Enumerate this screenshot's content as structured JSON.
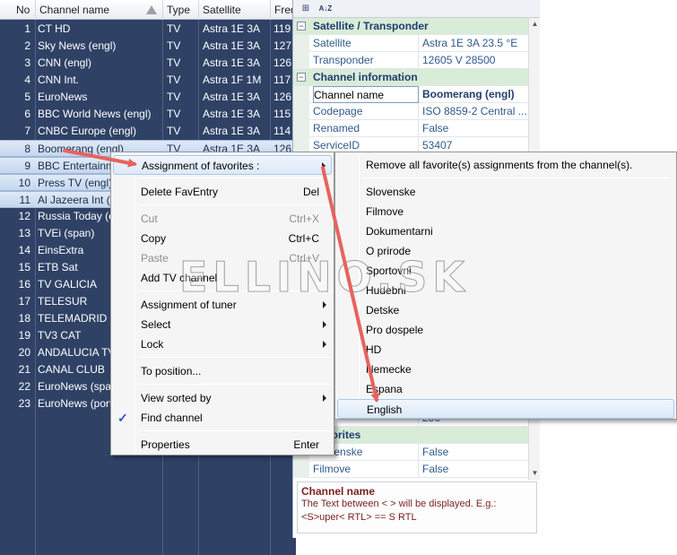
{
  "grid": {
    "columns": [
      "No",
      "Channel name",
      "Type",
      "Satellite",
      "Freq"
    ],
    "rows": [
      {
        "no": "1",
        "name": "CT HD",
        "type": "TV",
        "sat": "Astra 1E 3A",
        "freq": "119"
      },
      {
        "no": "2",
        "name": "Sky News (engl)",
        "type": "TV",
        "sat": "Astra 1E 3A",
        "freq": "127"
      },
      {
        "no": "3",
        "name": "CNN (engl)",
        "type": "TV",
        "sat": "Astra 1E 3A",
        "freq": "126"
      },
      {
        "no": "4",
        "name": "CNN Int.",
        "type": "TV",
        "sat": "Astra 1F 1M",
        "freq": "117"
      },
      {
        "no": "5",
        "name": "EuroNews",
        "type": "TV",
        "sat": "Astra 1E 3A",
        "freq": "126"
      },
      {
        "no": "6",
        "name": "BBC World News (engl)",
        "type": "TV",
        "sat": "Astra 1E 3A",
        "freq": "115"
      },
      {
        "no": "7",
        "name": "CNBC Europe (engl)",
        "type": "TV",
        "sat": "Astra 1E 3A",
        "freq": "114"
      },
      {
        "no": "8",
        "name": "Boomerang (engl)",
        "type": "TV",
        "sat": "Astra 1E 3A",
        "freq": "126"
      },
      {
        "no": "9",
        "name": "BBC Entertainm",
        "type": "",
        "sat": "",
        "freq": ""
      },
      {
        "no": "10",
        "name": "Press TV (engl)",
        "type": "",
        "sat": "",
        "freq": ""
      },
      {
        "no": "11",
        "name": "Al Jazeera Int (e",
        "type": "",
        "sat": "",
        "freq": ""
      },
      {
        "no": "12",
        "name": "Russia Today (e",
        "type": "",
        "sat": "",
        "freq": ""
      },
      {
        "no": "13",
        "name": "TVEi (span)",
        "type": "",
        "sat": "",
        "freq": ""
      },
      {
        "no": "14",
        "name": "EinsExtra",
        "type": "",
        "sat": "",
        "freq": ""
      },
      {
        "no": "15",
        "name": "ETB Sat",
        "type": "",
        "sat": "",
        "freq": ""
      },
      {
        "no": "16",
        "name": "TV GALICIA",
        "type": "",
        "sat": "",
        "freq": ""
      },
      {
        "no": "17",
        "name": "TELESUR",
        "type": "",
        "sat": "",
        "freq": ""
      },
      {
        "no": "18",
        "name": "TELEMADRID SA",
        "type": "",
        "sat": "",
        "freq": ""
      },
      {
        "no": "19",
        "name": "TV3 CAT",
        "type": "",
        "sat": "",
        "freq": ""
      },
      {
        "no": "20",
        "name": "ANDALUCIA TV",
        "type": "",
        "sat": "",
        "freq": ""
      },
      {
        "no": "21",
        "name": "CANAL CLUB",
        "type": "",
        "sat": "",
        "freq": ""
      },
      {
        "no": "22",
        "name": "EuroNews (span",
        "type": "",
        "sat": "",
        "freq": ""
      },
      {
        "no": "23",
        "name": "EuroNews (port",
        "type": "",
        "sat": "",
        "freq": ""
      }
    ],
    "selected_rows": [
      "8",
      "9",
      "10",
      "11"
    ]
  },
  "props": {
    "toolbar": {
      "categorized": "⊞",
      "alphabetical": "A↓Z"
    },
    "rows": [
      {
        "kind": "cat",
        "key": "Satellite / Transponder",
        "value": ""
      },
      {
        "kind": "prop",
        "key": "Satellite",
        "value": "Astra 1E 3A     23.5 °E"
      },
      {
        "kind": "prop",
        "key": "Transponder",
        "value": "12605 V 28500"
      },
      {
        "kind": "cat",
        "key": "Channel information",
        "value": ""
      },
      {
        "kind": "sel",
        "key": "Channel name",
        "value": "Boomerang (engl)"
      },
      {
        "kind": "prop",
        "key": "Codepage",
        "value": "ISO 8859-2 Central ..."
      },
      {
        "kind": "prop",
        "key": "Renamed",
        "value": "False"
      },
      {
        "kind": "prop",
        "key": "ServiceID",
        "value": "53407"
      },
      {
        "kind": "blank",
        "key": "",
        "value": ""
      },
      {
        "kind": "blank",
        "key": "",
        "value": ""
      },
      {
        "kind": "blank",
        "key": "",
        "value": ""
      },
      {
        "kind": "blank",
        "key": "",
        "value": ""
      },
      {
        "kind": "blank",
        "key": "",
        "value": ""
      },
      {
        "kind": "blank",
        "key": "",
        "value": ""
      },
      {
        "kind": "blank",
        "key": "",
        "value": ""
      },
      {
        "kind": "blank",
        "key": "",
        "value": ""
      },
      {
        "kind": "blank",
        "key": "",
        "value": ""
      },
      {
        "kind": "blank",
        "key": "",
        "value": ""
      },
      {
        "kind": "blank",
        "key": "",
        "value": ""
      },
      {
        "kind": "blank",
        "key": "",
        "value": ""
      },
      {
        "kind": "blank",
        "key": "",
        "value": ""
      },
      {
        "kind": "blank",
        "key": "",
        "value": ""
      },
      {
        "kind": "blank",
        "key": "",
        "value": ""
      },
      {
        "kind": "prop",
        "key": "",
        "value": "256"
      },
      {
        "kind": "cat",
        "key": "Favorites",
        "value": ""
      },
      {
        "kind": "prop",
        "key": "Slovenske",
        "value": "False"
      },
      {
        "kind": "prop",
        "key": "Filmove",
        "value": "False"
      }
    ],
    "description": {
      "title": "Channel name",
      "text": "The Text between < > will be displayed. E.g.: <S>uper< RTL> == S RTL"
    }
  },
  "context_menu": {
    "items": [
      {
        "type": "item",
        "label": "Assignment of favorites :",
        "shortcut": "",
        "submenu": true,
        "highlighted": true,
        "disabled": false
      },
      {
        "type": "sep"
      },
      {
        "type": "item",
        "label": "Delete FavEntry",
        "shortcut": "Del",
        "submenu": false,
        "highlighted": false,
        "disabled": false
      },
      {
        "type": "sep"
      },
      {
        "type": "item",
        "label": "Cut",
        "shortcut": "Ctrl+X",
        "submenu": false,
        "highlighted": false,
        "disabled": true
      },
      {
        "type": "item",
        "label": "Copy",
        "shortcut": "Ctrl+C",
        "submenu": false,
        "highlighted": false,
        "disabled": false
      },
      {
        "type": "item",
        "label": "Paste",
        "shortcut": "Ctrl+V",
        "submenu": false,
        "highlighted": false,
        "disabled": true
      },
      {
        "type": "item",
        "label": "Add TV channel",
        "shortcut": "",
        "submenu": false,
        "highlighted": false,
        "disabled": false
      },
      {
        "type": "sep"
      },
      {
        "type": "item",
        "label": "Assignment of tuner",
        "shortcut": "",
        "submenu": true,
        "highlighted": false,
        "disabled": false
      },
      {
        "type": "item",
        "label": "Select",
        "shortcut": "",
        "submenu": true,
        "highlighted": false,
        "disabled": false
      },
      {
        "type": "item",
        "label": "Lock",
        "shortcut": "",
        "submenu": true,
        "highlighted": false,
        "disabled": false
      },
      {
        "type": "sep"
      },
      {
        "type": "item",
        "label": "To position...",
        "shortcut": "",
        "submenu": false,
        "highlighted": false,
        "disabled": false
      },
      {
        "type": "sep"
      },
      {
        "type": "item",
        "label": "View sorted by",
        "shortcut": "",
        "submenu": true,
        "highlighted": false,
        "disabled": false
      },
      {
        "type": "item",
        "label": "Find channel",
        "shortcut": "",
        "submenu": false,
        "highlighted": false,
        "disabled": false,
        "checked": true
      },
      {
        "type": "sep"
      },
      {
        "type": "item",
        "label": "Properties",
        "shortcut": "Enter",
        "submenu": false,
        "highlighted": false,
        "disabled": false
      }
    ]
  },
  "submenu": {
    "items": [
      {
        "type": "item",
        "label": "Remove all favorite(s) assignments from the channel(s).",
        "highlighted": false
      },
      {
        "type": "sep"
      },
      {
        "type": "item",
        "label": "Slovenske",
        "highlighted": false
      },
      {
        "type": "item",
        "label": "Filmove",
        "highlighted": false
      },
      {
        "type": "item",
        "label": "Dokumentarni",
        "highlighted": false
      },
      {
        "type": "item",
        "label": "O prirode",
        "highlighted": false
      },
      {
        "type": "item",
        "label": "Sportovni",
        "highlighted": false
      },
      {
        "type": "item",
        "label": "Hudebni",
        "highlighted": false
      },
      {
        "type": "item",
        "label": "Detske",
        "highlighted": false
      },
      {
        "type": "item",
        "label": "Pro dospele",
        "highlighted": false
      },
      {
        "type": "item",
        "label": "HD",
        "highlighted": false
      },
      {
        "type": "item",
        "label": "Nemecke",
        "highlighted": false
      },
      {
        "type": "item",
        "label": "Espana",
        "highlighted": false
      },
      {
        "type": "item",
        "label": "English",
        "highlighted": true
      }
    ]
  },
  "watermark": {
    "text": "ELLINO.SK"
  },
  "colors": {
    "grid_bg": "#2f4266",
    "arrow": "#e8625f",
    "category_bg": "#d9ecd8",
    "property_text": "#2f5a8c",
    "description_text": "#7a1f1f"
  }
}
